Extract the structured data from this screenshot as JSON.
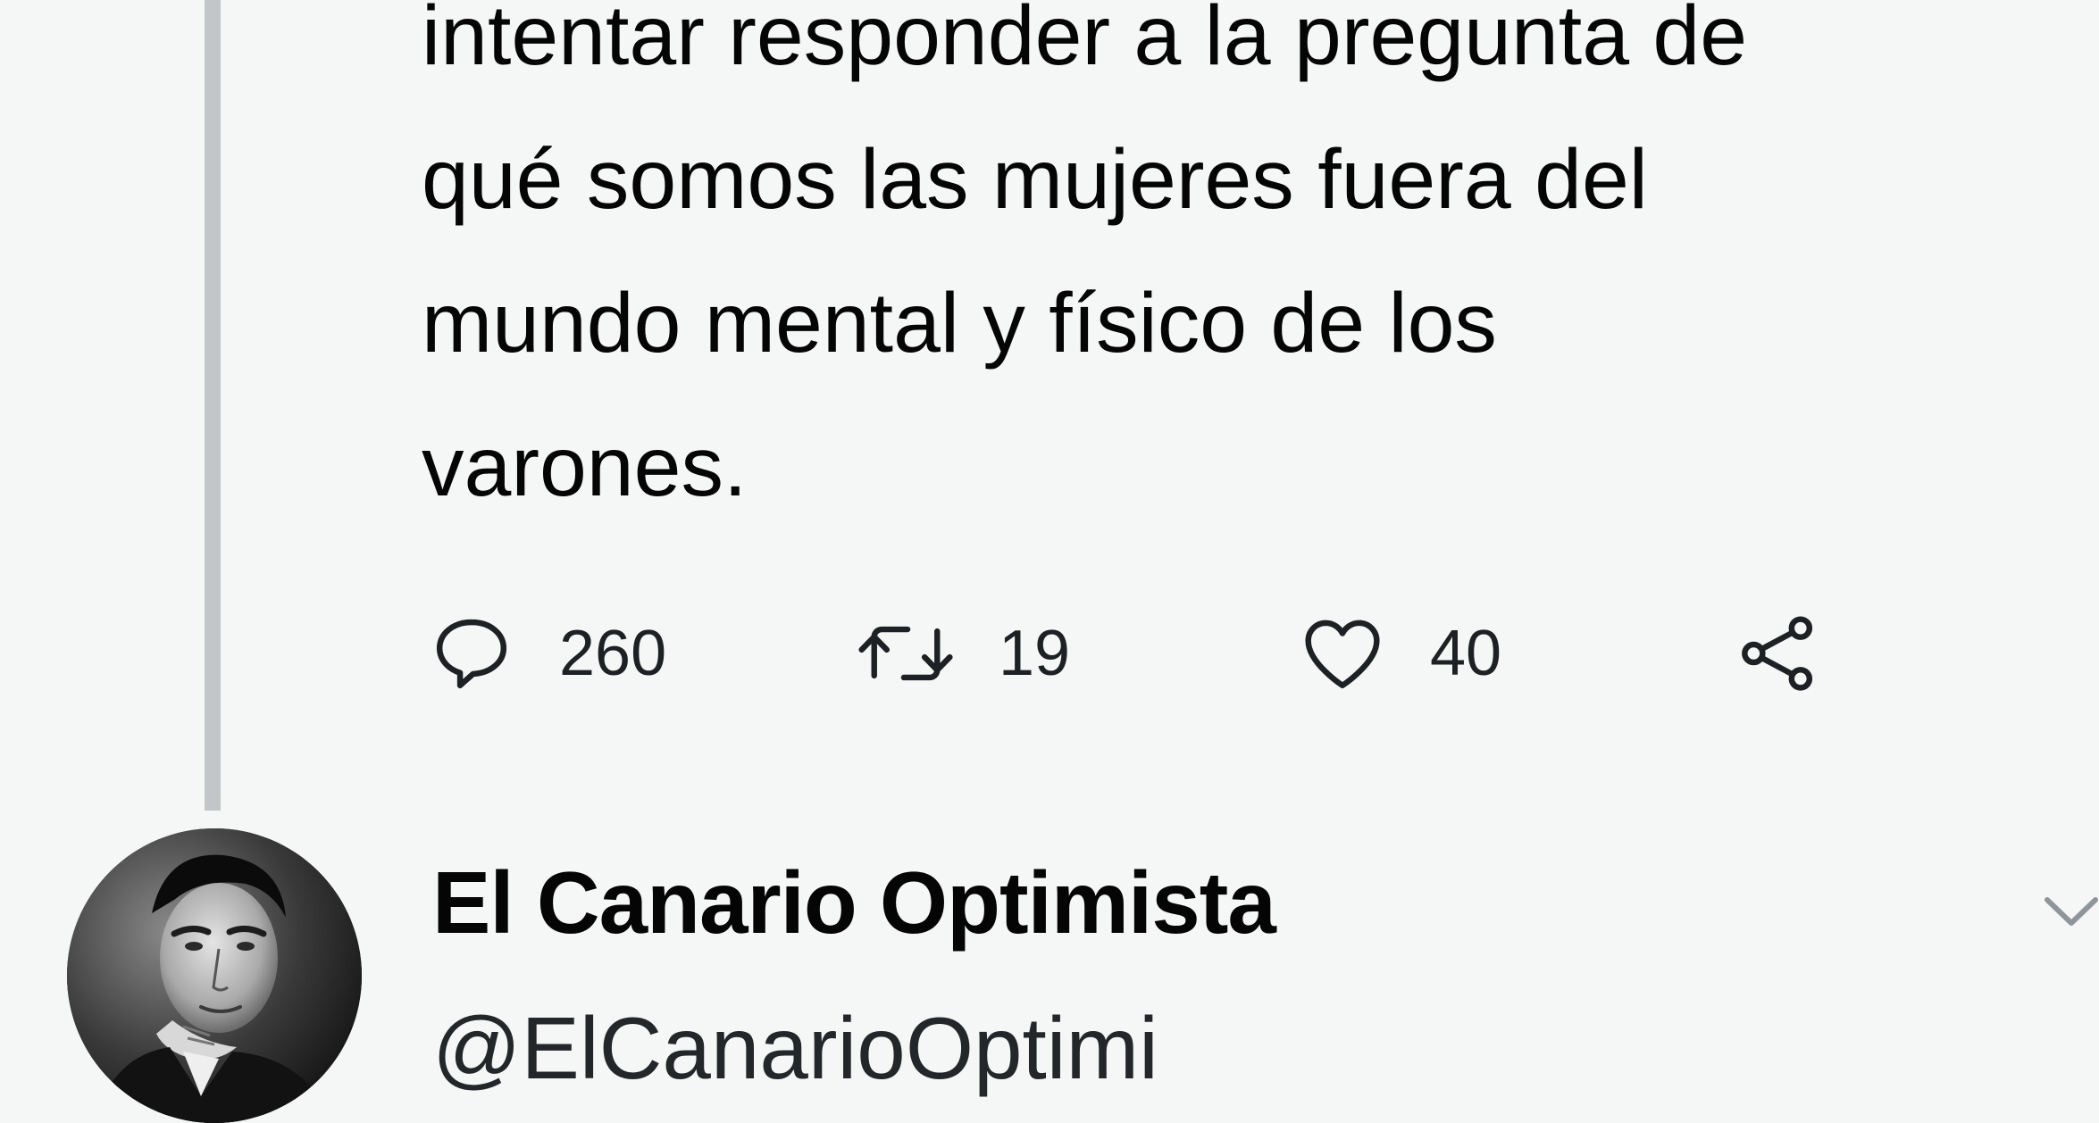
{
  "tweet": {
    "text_lines": [
      "intentar responder a la pregunta de",
      "qué somos las mujeres fuera del",
      "mundo mental y físico de los",
      "varones."
    ],
    "actions": {
      "replies": "260",
      "retweets": "19",
      "likes": "40"
    }
  },
  "next_tweet": {
    "display_name": "El Canario Optimista",
    "handle": "@ElCanarioOptimi"
  },
  "icons": [
    "reply-icon",
    "retweet-icon",
    "like-icon",
    "share-icon",
    "chevron-down-icon"
  ],
  "colors": {
    "background": "#f5f6f6",
    "text": "#050505",
    "icon": "#1e2124",
    "thread_line": "#c2c6c9"
  }
}
